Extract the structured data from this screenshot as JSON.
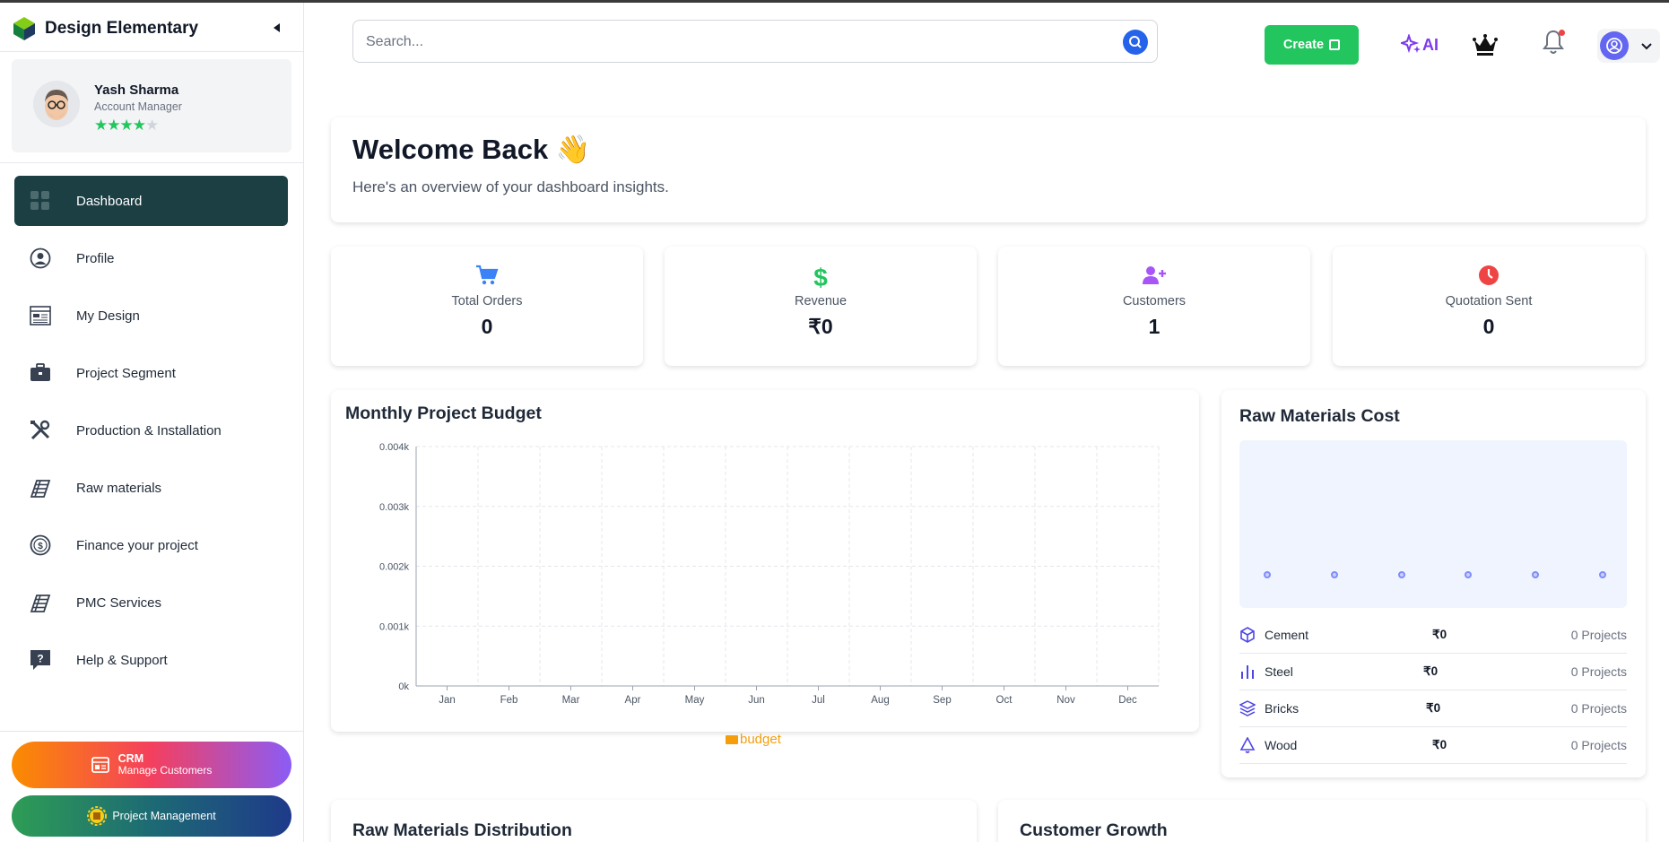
{
  "brand": {
    "title": "Design Elementary"
  },
  "user": {
    "name": "Yash Sharma",
    "role": "Account Manager",
    "rating": 4,
    "rating_max": 5
  },
  "nav": [
    {
      "label": "Dashboard",
      "icon": "dashboard-icon",
      "active": true
    },
    {
      "label": "Profile",
      "icon": "user-circle-icon"
    },
    {
      "label": "My Design",
      "icon": "design-icon"
    },
    {
      "label": "Project Segment",
      "icon": "briefcase-icon"
    },
    {
      "label": "Production & Installation",
      "icon": "tools-icon"
    },
    {
      "label": "Raw materials",
      "icon": "materials-icon"
    },
    {
      "label": "Finance your project",
      "icon": "dollar-circle-icon"
    },
    {
      "label": "PMC Services",
      "icon": "materials-icon"
    },
    {
      "label": "Help & Support",
      "icon": "help-icon"
    }
  ],
  "crm": {
    "title": "CRM",
    "subtitle": "Manage Customers"
  },
  "project_management": {
    "label": "Project Management"
  },
  "search": {
    "placeholder": "Search..."
  },
  "header": {
    "create_label": "Create",
    "ai_label": "AI"
  },
  "welcome": {
    "title": "Welcome Back 👋",
    "subtitle": "Here's an overview of your dashboard insights."
  },
  "stats": [
    {
      "label": "Total Orders",
      "value": "0",
      "icon": "cart-icon",
      "color": "#3b82f6"
    },
    {
      "label": "Revenue",
      "value": "₹0",
      "icon": "dollar-icon",
      "color": "#22c55e"
    },
    {
      "label": "Customers",
      "value": "1",
      "icon": "user-plus-icon",
      "color": "#a855f7"
    },
    {
      "label": "Quotation Sent",
      "value": "0",
      "icon": "clock-icon",
      "color": "#ef4444"
    }
  ],
  "monthly_chart": {
    "title": "Monthly Project Budget",
    "legend": "budget"
  },
  "chart_data": {
    "type": "bar",
    "title": "Monthly Project Budget",
    "categories": [
      "Jan",
      "Feb",
      "Mar",
      "Apr",
      "May",
      "Jun",
      "Jul",
      "Aug",
      "Sep",
      "Oct",
      "Nov",
      "Dec"
    ],
    "series": [
      {
        "name": "budget",
        "values": [
          0,
          0,
          0,
          0,
          0,
          0,
          0,
          0,
          0,
          0,
          0,
          0
        ],
        "color": "#f59e0b"
      }
    ],
    "yticks": [
      "0k",
      "0.001k",
      "0.002k",
      "0.003k",
      "0.004k"
    ],
    "ylim": [
      0,
      4
    ],
    "grid": true,
    "legend_position": "bottom"
  },
  "raw_materials": {
    "title": "Raw Materials Cost",
    "items": [
      {
        "name": "Cement",
        "cost": "₹0",
        "projects": "0 Projects",
        "icon": "cube-icon"
      },
      {
        "name": "Steel",
        "cost": "₹0",
        "projects": "0 Projects",
        "icon": "bar-chart-icon"
      },
      {
        "name": "Bricks",
        "cost": "₹0",
        "projects": "0 Projects",
        "icon": "layers-icon"
      },
      {
        "name": "Wood",
        "cost": "₹0",
        "projects": "0 Projects",
        "icon": "bell-outline-icon"
      }
    ]
  },
  "bottom_cards": [
    {
      "title": "Raw Materials Distribution"
    },
    {
      "title": "Customer Growth"
    }
  ],
  "colors": {
    "accent": "#1c3f44",
    "create": "#22c55e",
    "search_button": "#2563eb",
    "ai": "#7c3aed"
  }
}
